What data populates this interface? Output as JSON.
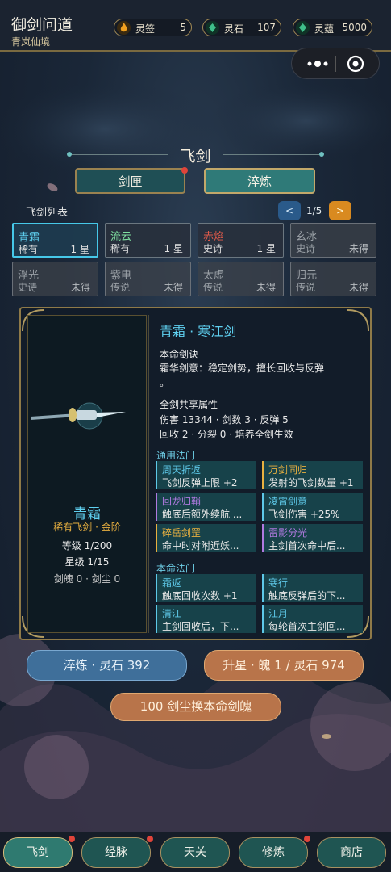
{
  "header": {
    "title": "御剑问道",
    "subtitle": "青岚仙境"
  },
  "resources": [
    {
      "label": "灵签",
      "value": "5",
      "icon": "flame-icon",
      "color": "#f0a020"
    },
    {
      "label": "灵石",
      "value": "107",
      "icon": "jade-stone-icon",
      "color": "#3fbf8a"
    },
    {
      "label": "灵蕴",
      "value": "5000",
      "icon": "jade-stone-icon",
      "color": "#3fbf8a"
    }
  ],
  "capsule": {
    "more": "•●•",
    "close": "◉"
  },
  "section": {
    "title": "飞剑",
    "tabs": [
      "剑匣",
      "淬炼"
    ]
  },
  "list": {
    "title": "飞剑列表",
    "page": "1/5",
    "prev": "<",
    "next": ">"
  },
  "swords": [
    {
      "name": "青霜",
      "rarity": "稀有",
      "status": "1 星",
      "owned": true,
      "selected": true,
      "name_color": "#5fd0f0",
      "rarity_color": "#e0e0e0"
    },
    {
      "name": "流云",
      "rarity": "稀有",
      "status": "1 星",
      "owned": true,
      "selected": false,
      "name_color": "#7fe0a0",
      "rarity_color": "#e0e0e0"
    },
    {
      "name": "赤焰",
      "rarity": "史诗",
      "status": "1 星",
      "owned": true,
      "selected": false,
      "name_color": "#e05a4a",
      "rarity_color": "#e0e0e0"
    },
    {
      "name": "玄冰",
      "rarity": "史诗",
      "status": "未得",
      "owned": false,
      "selected": false,
      "name_color": "#9aa0a6",
      "rarity_color": "#9aa0a6"
    },
    {
      "name": "浮光",
      "rarity": "史诗",
      "status": "未得",
      "owned": false,
      "selected": false,
      "name_color": "#9aa0a6",
      "rarity_color": "#9aa0a6"
    },
    {
      "name": "紫电",
      "rarity": "传说",
      "status": "未得",
      "owned": false,
      "selected": false,
      "name_color": "#9aa0a6",
      "rarity_color": "#9aa0a6"
    },
    {
      "name": "太虚",
      "rarity": "传说",
      "status": "未得",
      "owned": false,
      "selected": false,
      "name_color": "#9aa0a6",
      "rarity_color": "#9aa0a6"
    },
    {
      "name": "归元",
      "rarity": "传说",
      "status": "未得",
      "owned": false,
      "selected": false,
      "name_color": "#9aa0a6",
      "rarity_color": "#9aa0a6"
    }
  ],
  "detail": {
    "name": "青霜",
    "grade": "稀有飞剑 · 金阶",
    "level": "等级 1/200",
    "star": "星级 1/15",
    "souls": "剑魄 0 · 剑尘 0",
    "header": "青霜 · 寒江剑",
    "skill_title": "本命剑诀",
    "skill_line1": "霜华剑意：稳定剑势，擅长回收与反弹",
    "skill_line2": "。",
    "shared_title": "全剑共享属性",
    "shared_line1": "伤害 13344 · 剑数 3 · 反弹 5",
    "shared_line2": "回收 2 · 分裂 0 · 培养全剑生效",
    "general_title": "通用法门",
    "own_title": "本命法门"
  },
  "general_spells": [
    {
      "title": "周天折返",
      "desc": "飞剑反弹上限 +2",
      "color": "#5ec8e8"
    },
    {
      "title": "万剑同归",
      "desc": "发射的飞剑数量 +1",
      "color": "#e8b040"
    },
    {
      "title": "回龙归鞘",
      "desc": "触底后额外续航 ...",
      "color": "#b07ae0"
    },
    {
      "title": "凌霄剑意",
      "desc": "飞剑伤害 +25%",
      "color": "#5ec8e8"
    },
    {
      "title": "碎岳剑罡",
      "desc": "命中时对附近妖...",
      "color": "#e8b040"
    },
    {
      "title": "雷影分光",
      "desc": "主剑首次命中后...",
      "color": "#b07ae0"
    }
  ],
  "own_spells": [
    {
      "title": "霜返",
      "desc": "触底回收次数 +1",
      "color": "#5ec8e8"
    },
    {
      "title": "寒行",
      "desc": "触底反弹后的下...",
      "color": "#5ec8e8"
    },
    {
      "title": "清江",
      "desc": "主剑回收后，下...",
      "color": "#5ec8e8"
    },
    {
      "title": "江月",
      "desc": "每轮首次主剑回...",
      "color": "#5ec8e8"
    }
  ],
  "actions": {
    "refine": "淬炼 · 灵石 392",
    "upstar": "升星 · 魄 1 / 灵石 974",
    "exchange": "100 剑尘换本命剑魄"
  },
  "nav": [
    "飞剑",
    "经脉",
    "天关",
    "修炼",
    "商店"
  ],
  "colors": {
    "accent_gold": "#a28a55",
    "teal": "#2f6f6c",
    "selected_border": "#46c8e8"
  }
}
